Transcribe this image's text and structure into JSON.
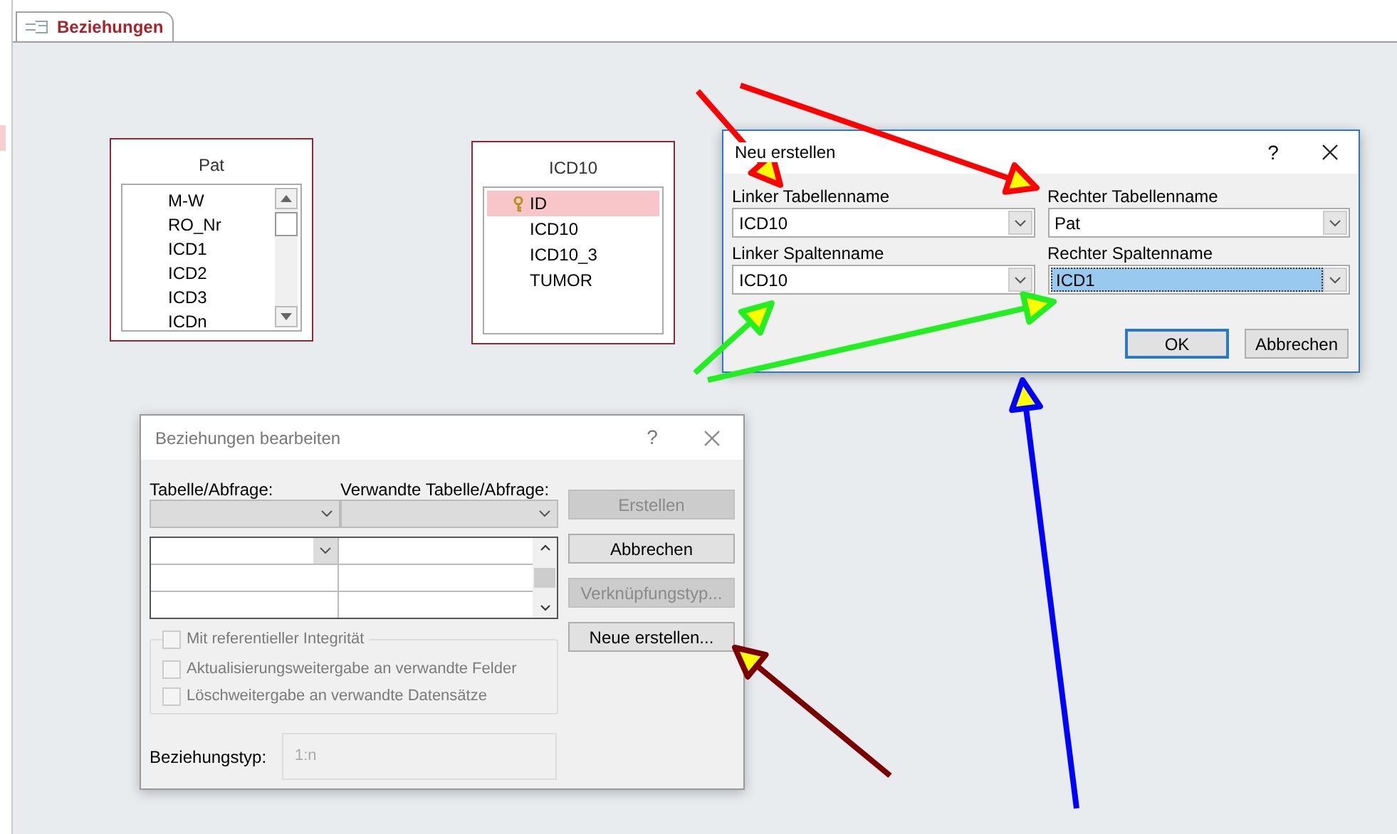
{
  "document_tab": {
    "label": "Beziehungen",
    "selected": true
  },
  "tables": [
    {
      "title": "Pat",
      "fields": [
        {
          "name": "M-W",
          "primary_key": false,
          "selected": false
        },
        {
          "name": "RO_Nr",
          "primary_key": false,
          "selected": false
        },
        {
          "name": "ICD1",
          "primary_key": false,
          "selected": false
        },
        {
          "name": "ICD2",
          "primary_key": false,
          "selected": false
        },
        {
          "name": "ICD3",
          "primary_key": false,
          "selected": false
        },
        {
          "name": "ICDn",
          "primary_key": false,
          "selected": false
        }
      ],
      "scrollbar": true
    },
    {
      "title": "ICD10",
      "fields": [
        {
          "name": "ID",
          "primary_key": true,
          "selected": true
        },
        {
          "name": "ICD10",
          "primary_key": false,
          "selected": false
        },
        {
          "name": "ICD10_3",
          "primary_key": false,
          "selected": false
        },
        {
          "name": "TUMOR",
          "primary_key": false,
          "selected": false
        }
      ],
      "scrollbar": false
    }
  ],
  "new_dialog": {
    "title": "Neu erstellen",
    "help": "?",
    "fields": [
      {
        "label": "Linker Tabellenname",
        "value": "ICD10",
        "selected": false
      },
      {
        "label": "Rechter Tabellenname",
        "value": "Pat",
        "selected": false
      },
      {
        "label": "Linker Spaltenname",
        "value": "ICD10",
        "selected": false
      },
      {
        "label": "Rechter Spaltenname",
        "value": "ICD1",
        "selected": true
      }
    ],
    "buttons": [
      {
        "label": "OK",
        "default": true
      },
      {
        "label": "Abbrechen",
        "default": false
      }
    ]
  },
  "edit_dialog": {
    "title": "Beziehungen bearbeiten",
    "help": "?",
    "table_label": "Tabelle/Abfrage:",
    "related_label": "Verwandte Tabelle/Abfrage:",
    "buttons": [
      {
        "label": "Erstellen",
        "disabled": true
      },
      {
        "label": "Abbrechen",
        "disabled": false
      },
      {
        "label": "Verknüpfungstyp...",
        "disabled": true
      },
      {
        "label": "Neue erstellen...",
        "disabled": false
      }
    ],
    "checkboxes": [
      {
        "label": "Mit referentieller Integrität",
        "checked": false,
        "disabled": true
      },
      {
        "label": "Aktualisierungsweitergabe an verwandte Felder",
        "checked": false,
        "disabled": true
      },
      {
        "label": "Löschweitergabe an verwandte Datensätze",
        "checked": false,
        "disabled": true
      }
    ],
    "relation_type_label": "Beziehungstyp:",
    "relation_type": "1:n"
  },
  "arrows": [
    {
      "color": "#ff0000"
    },
    {
      "color": "#ff0000"
    },
    {
      "color": "#22ee22"
    },
    {
      "color": "#22ee22"
    },
    {
      "color": "#0000ff"
    },
    {
      "color": "#7a0000"
    }
  ]
}
